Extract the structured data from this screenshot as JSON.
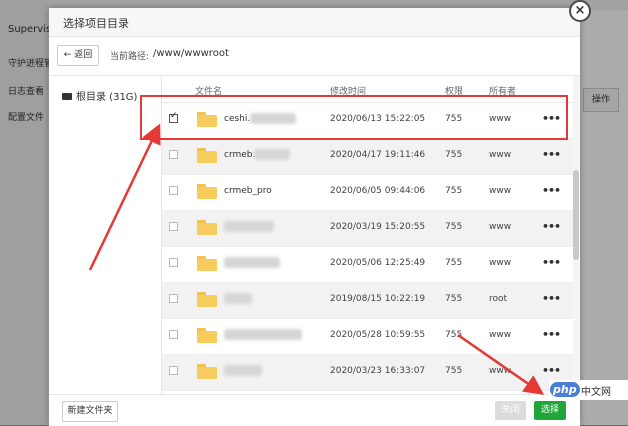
{
  "background": {
    "top_text": "",
    "sidebar_items": [
      "Supervis",
      "守护进程管",
      "日志查看",
      "配置文件"
    ],
    "right_button": "操作"
  },
  "dialog": {
    "title": "选择项目目录",
    "close_icon": "close-icon",
    "back_label": "返回",
    "path_label": "当前路径:",
    "path_value": "/www/wwwroot",
    "tree_root": "根目录 (31G)",
    "columns": {
      "name": "文件名",
      "modified": "修改时间",
      "permission": "权限",
      "owner": "所有者"
    },
    "rows": [
      {
        "name": "ceshi.",
        "date": "2020/06/13 15:22:05",
        "perm": "755",
        "owner": "www",
        "more": "•••",
        "checked": true
      },
      {
        "name": "crmeb.",
        "date": "2020/04/17 19:11:46",
        "perm": "755",
        "owner": "www",
        "more": "•••",
        "checked": false
      },
      {
        "name": "crmeb_pro",
        "date": "2020/06/05 09:44:06",
        "perm": "755",
        "owner": "www",
        "more": "•••",
        "checked": false
      },
      {
        "name": "",
        "date": "2020/03/19 15:20:55",
        "perm": "755",
        "owner": "www",
        "more": "•••",
        "checked": false
      },
      {
        "name": "",
        "date": "2020/05/06 12:25:49",
        "perm": "755",
        "owner": "www",
        "more": "•••",
        "checked": false
      },
      {
        "name": "",
        "date": "2019/08/15 10:22:19",
        "perm": "755",
        "owner": "root",
        "more": "•••",
        "checked": false
      },
      {
        "name": "",
        "date": "2020/05/28 10:59:55",
        "perm": "755",
        "owner": "www",
        "more": "•••",
        "checked": false
      },
      {
        "name": "",
        "date": "2020/03/23 16:33:07",
        "perm": "755",
        "owner": "www",
        "more": "•••",
        "checked": false
      }
    ],
    "new_folder_label": "新建文件夹",
    "close_label": "关闭",
    "select_label": "选择"
  },
  "watermark": {
    "logo": "php",
    "text": "中文网"
  },
  "colors": {
    "accent_green": "#20a53a",
    "annotation_red": "#e53935",
    "folder_yellow": "#f6cc5c"
  }
}
